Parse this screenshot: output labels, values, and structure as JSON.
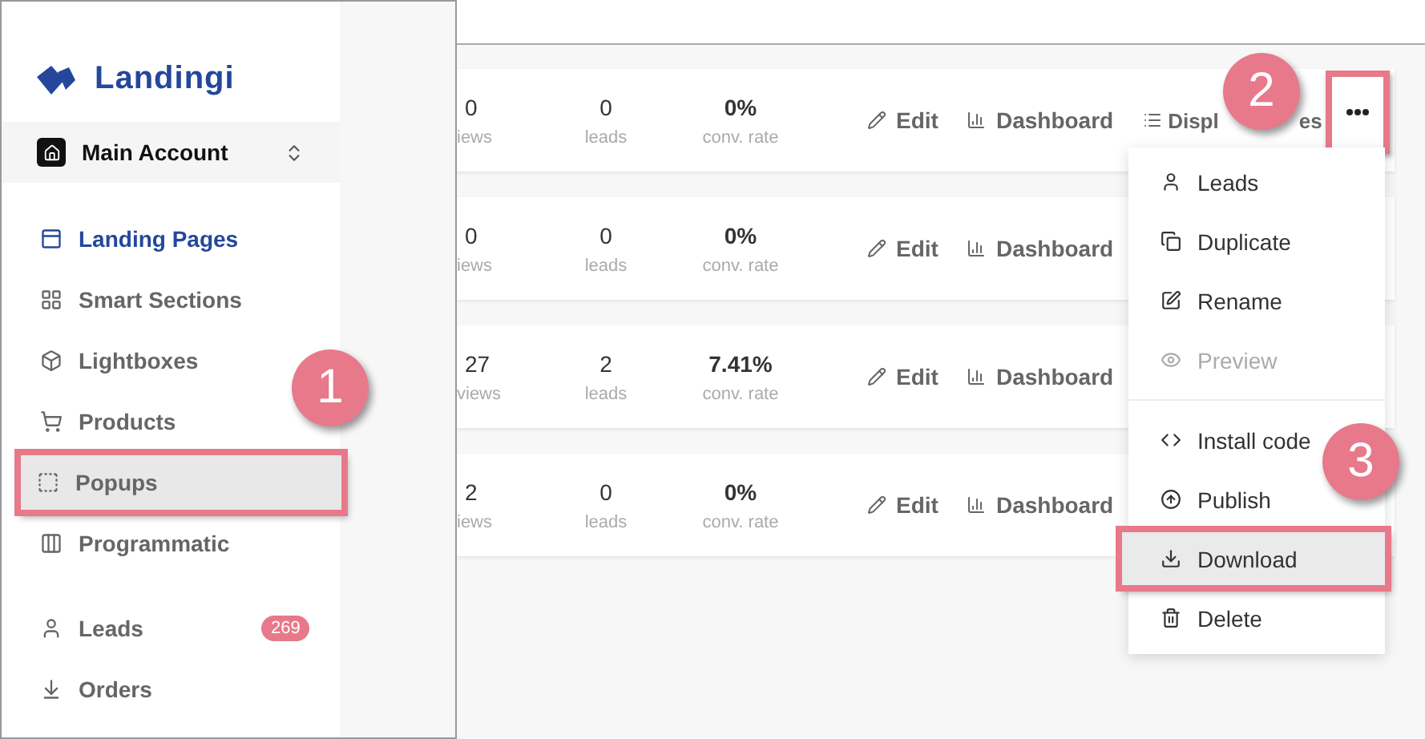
{
  "sidebar": {
    "logo": "Landingi",
    "account": "Main Account",
    "nav": [
      {
        "label": "Landing Pages",
        "selected": true,
        "highlighted": false
      },
      {
        "label": "Smart Sections",
        "selected": false,
        "highlighted": false
      },
      {
        "label": "Lightboxes",
        "selected": false,
        "highlighted": false
      },
      {
        "label": "Products",
        "selected": false,
        "highlighted": false
      },
      {
        "label": "Popups",
        "selected": false,
        "highlighted": true
      },
      {
        "label": "Programmatic",
        "selected": false,
        "highlighted": false
      }
    ],
    "footer_nav": [
      {
        "label": "Leads",
        "badge": "269"
      },
      {
        "label": "Orders"
      }
    ]
  },
  "rows": [
    {
      "views": "0",
      "views_label": "iews",
      "leads": "0",
      "leads_label": "leads",
      "rate": "0%",
      "rate_label": "conv. rate",
      "edit": "Edit",
      "dashboard": "Dashboard",
      "display_start": "Displ",
      "display_end": "es"
    },
    {
      "views": "0",
      "views_label": "iews",
      "leads": "0",
      "leads_label": "leads",
      "rate": "0%",
      "rate_label": "conv. rate",
      "edit": "Edit",
      "dashboard": "Dashboard"
    },
    {
      "views": "27",
      "views_label": "views",
      "leads": "2",
      "leads_label": "leads",
      "rate": "7.41%",
      "rate_label": "conv. rate",
      "edit": "Edit",
      "dashboard": "Dashboard"
    },
    {
      "views": "2",
      "views_label": "iews",
      "leads": "0",
      "leads_label": "leads",
      "rate": "0%",
      "rate_label": "conv. rate",
      "edit": "Edit",
      "dashboard": "Dashboard"
    }
  ],
  "menu": [
    {
      "label": "Leads",
      "disabled": false,
      "highlighted": false
    },
    {
      "label": "Duplicate",
      "disabled": false,
      "highlighted": false
    },
    {
      "label": "Rename",
      "disabled": false,
      "highlighted": false
    },
    {
      "label": "Preview",
      "disabled": true,
      "highlighted": false
    },
    {
      "label": "Install code",
      "disabled": false,
      "highlighted": false
    },
    {
      "label": "Publish",
      "disabled": false,
      "highlighted": false
    },
    {
      "label": "Download",
      "disabled": false,
      "highlighted": true
    },
    {
      "label": "Delete",
      "disabled": false,
      "highlighted": false
    }
  ],
  "callouts": [
    "1",
    "2",
    "3"
  ]
}
